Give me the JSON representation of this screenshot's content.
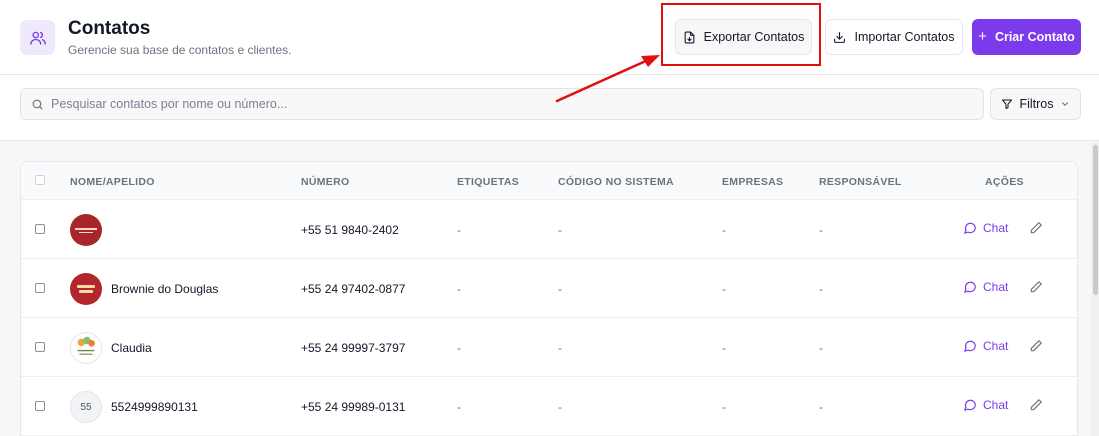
{
  "header": {
    "title": "Contatos",
    "subtitle": "Gerencie sua base de contatos e clientes.",
    "export_label": "Exportar Contatos",
    "import_label": "Importar Contatos",
    "create_label": "Criar Contato",
    "create_plus": "+"
  },
  "search": {
    "placeholder": "Pesquisar contatos por nome ou número..."
  },
  "filters": {
    "label": "Filtros"
  },
  "table": {
    "columns": [
      "NOME/APELIDO",
      "NÚMERO",
      "ETIQUETAS",
      "CÓDIGO NO SISTEMA",
      "EMPRESAS",
      "RESPONSÁVEL",
      "AÇÕES"
    ],
    "rows": [
      {
        "name": "",
        "number": "+55 51 9840-2402",
        "tags": "-",
        "code": "-",
        "companies": "-",
        "owner": "-",
        "chat": "Chat",
        "avatar": "logo-red"
      },
      {
        "name": "Brownie do Douglas",
        "number": "+55 24 97402-0877",
        "tags": "-",
        "code": "-",
        "companies": "-",
        "owner": "-",
        "chat": "Chat",
        "avatar": "logo-brownie"
      },
      {
        "name": "Claudia",
        "number": "+55 24 99997-3797",
        "tags": "-",
        "code": "-",
        "companies": "-",
        "owner": "-",
        "chat": "Chat",
        "avatar": "logo-floral"
      },
      {
        "name": "5524999890131",
        "number": "+55 24 99989-0131",
        "tags": "-",
        "code": "-",
        "companies": "-",
        "owner": "-",
        "chat": "Chat",
        "avatar": "initials",
        "initials": "55"
      }
    ]
  },
  "colors": {
    "accent": "#7c3aed",
    "highlight": "#e01010"
  }
}
